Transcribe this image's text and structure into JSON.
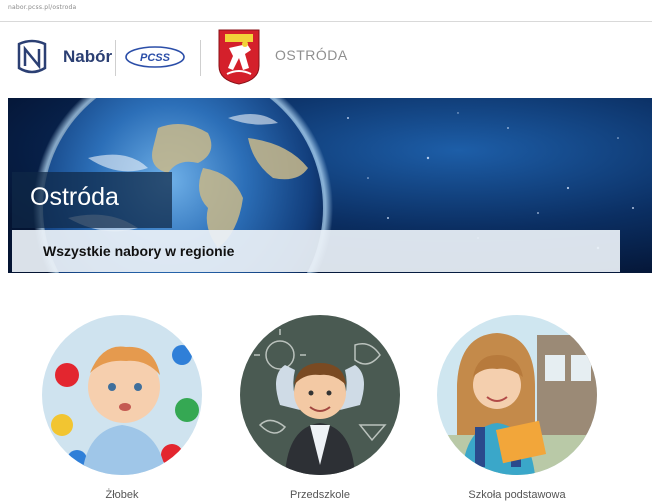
{
  "browser": {
    "url_text": "nabor.pcss.pl/ostroda"
  },
  "header": {
    "brand_label": "Nabór",
    "partner_logo_text": "PCSS",
    "city_label": "OSTRÓDA"
  },
  "hero": {
    "title": "Ostróda",
    "subtitle": "Wszystkie nabory w regionie"
  },
  "categories": [
    {
      "label": "Żłobek",
      "icon": "toddler-photo"
    },
    {
      "label": "Przedszkole",
      "icon": "preschooler-photo"
    },
    {
      "label": "Szkoła podstawowa",
      "icon": "schoolgirl-photo"
    }
  ],
  "colors": {
    "brand_navy": "#2b3f73",
    "hero_overlay": "#0f2846",
    "subtitle_bar": "#ebf1f7",
    "crest_red": "#d4202b"
  }
}
